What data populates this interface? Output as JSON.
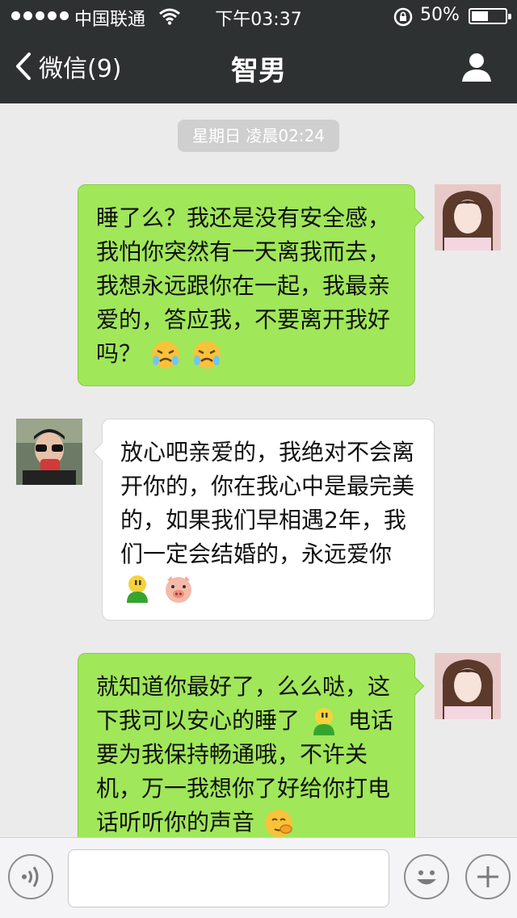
{
  "status_bar": {
    "carrier": "中国联通",
    "time": "下午03:37",
    "battery": "50%",
    "battery_level": 0.5
  },
  "nav": {
    "back_label": "微信(9)",
    "title": "智男"
  },
  "chat": {
    "timestamp": "星期日 凌晨02:24",
    "messages": [
      {
        "side": "out",
        "lines": [
          "睡了么？我还是没有安全感，",
          "我怕你突然有一天离我而去，",
          "我想永远跟你在一起，我最亲",
          "爱的，答应我，不要离开我好",
          "吗？"
        ],
        "emoji": [
          "crying-face",
          "crying-face"
        ]
      },
      {
        "side": "in",
        "lines": [
          "放心吧亲爱的，我绝对不会离",
          "开你的，你在我心中是最完美",
          "的，如果我们早相遇2年，我",
          "们一定会结婚的，永远爱你"
        ],
        "emoji": [
          "green-buddy",
          "pig-face"
        ]
      },
      {
        "side": "out",
        "lines": [
          "就知道你最好了，么么哒，这",
          "下我可以安心的睡了",
          "电话",
          "要为我保持畅通哦，不许关",
          "机，万一我想你了好给你打电",
          "话听听你的声音"
        ],
        "emoji": [
          "green-buddy",
          "shy-face"
        ]
      }
    ]
  },
  "input_bar": {
    "voice_icon": "voice-icon",
    "emoji_icon": "smiley-icon",
    "plus_icon": "plus-icon"
  },
  "colors": {
    "header_bg": "#2e3132",
    "chat_bg": "#ebebeb",
    "outgoing_bubble": "#a0e75a",
    "incoming_bubble": "#ffffff"
  }
}
